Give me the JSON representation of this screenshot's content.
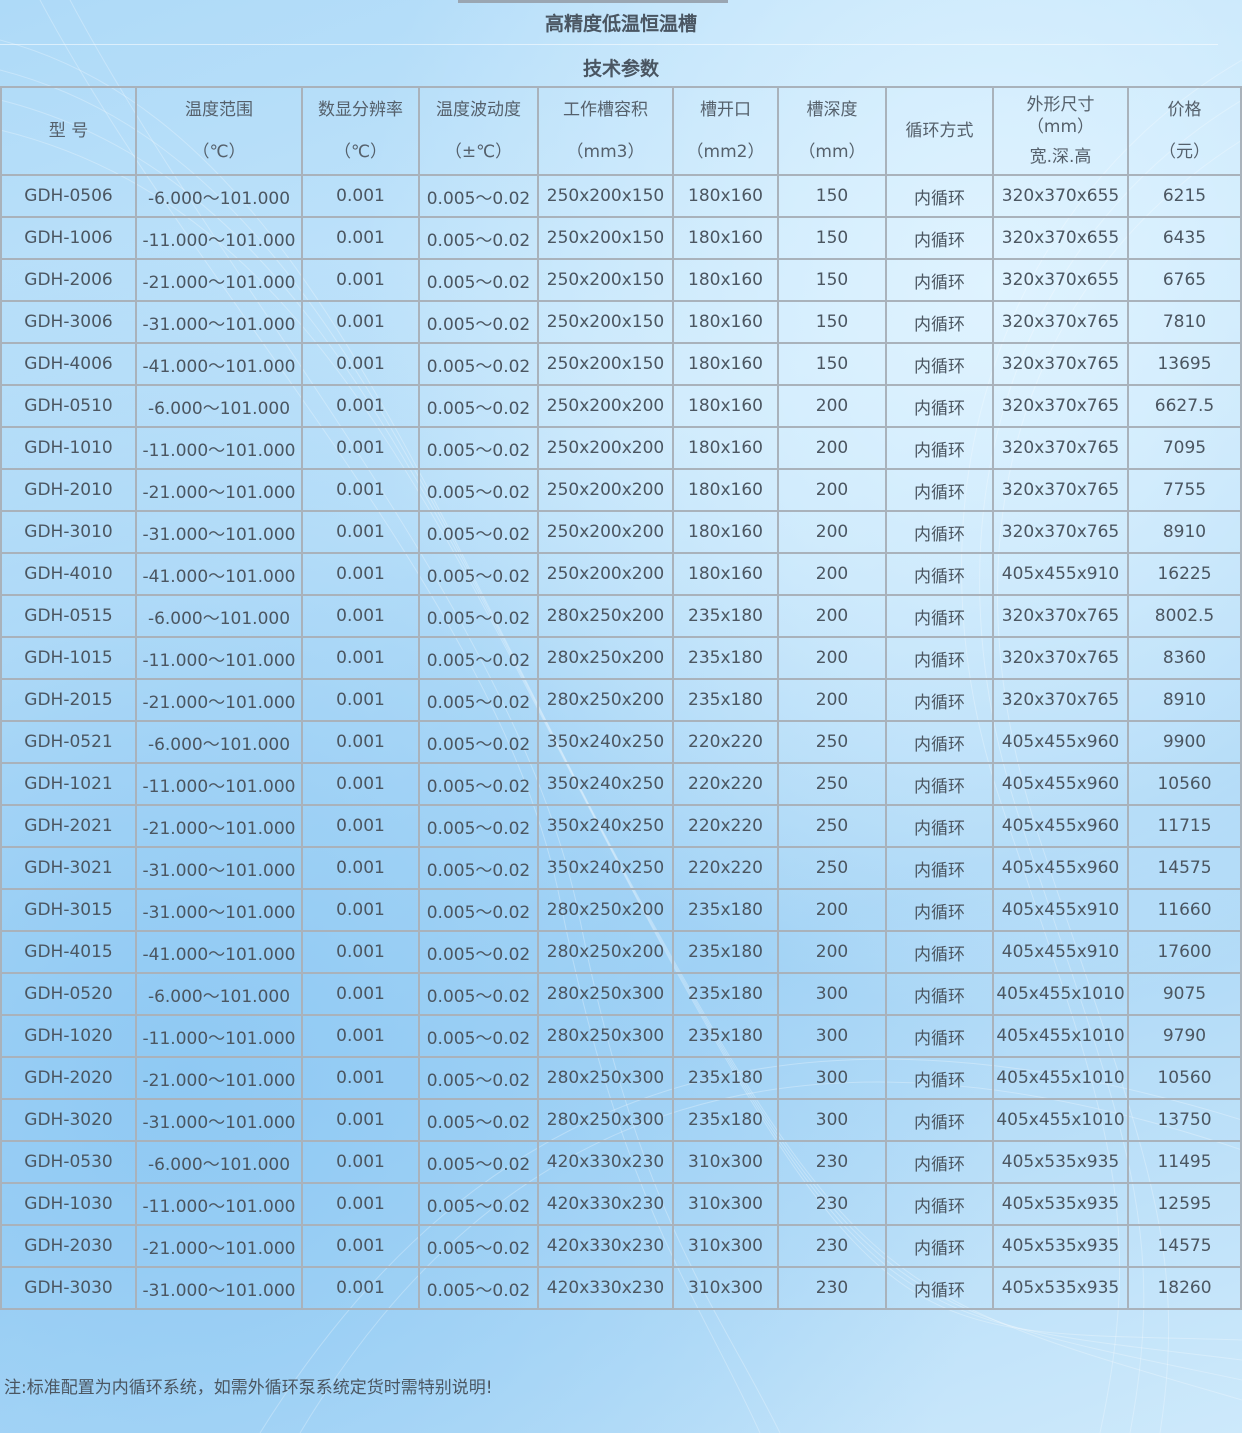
{
  "title": "高精度低温恒温槽",
  "subtitle": "技术参数",
  "headers": {
    "model": "型 号",
    "temp_range": "温度范围",
    "temp_range_unit": "（℃）",
    "resolution": "数显分辨率",
    "resolution_unit": "（℃）",
    "fluctuation": "温度波动度",
    "fluctuation_unit": "（±℃）",
    "volume": "工作槽容积",
    "volume_unit": "（mm3）",
    "opening": "槽开口",
    "opening_unit": "（mm2）",
    "depth": "槽深度",
    "depth_unit": "（mm）",
    "circulation": "循环方式",
    "dims": "外形尺寸",
    "dims_unit": "（mm）",
    "dims_sub": "宽.深.高",
    "price": "价格",
    "price_unit": "（元）"
  },
  "rows": [
    [
      "GDH-0506",
      "-6.000～101.000",
      "0.001",
      "0.005～0.02",
      "250x200x150",
      "180x160",
      "150",
      "内循环",
      "320x370x655",
      "6215"
    ],
    [
      "GDH-1006",
      "-11.000～101.000",
      "0.001",
      "0.005～0.02",
      "250x200x150",
      "180x160",
      "150",
      "内循环",
      "320x370x655",
      "6435"
    ],
    [
      "GDH-2006",
      "-21.000～101.000",
      "0.001",
      "0.005～0.02",
      "250x200x150",
      "180x160",
      "150",
      "内循环",
      "320x370x655",
      "6765"
    ],
    [
      "GDH-3006",
      "-31.000～101.000",
      "0.001",
      "0.005～0.02",
      "250x200x150",
      "180x160",
      "150",
      "内循环",
      "320x370x765",
      "7810"
    ],
    [
      "GDH-4006",
      "-41.000～101.000",
      "0.001",
      "0.005～0.02",
      "250x200x150",
      "180x160",
      "150",
      "内循环",
      "320x370x765",
      "13695"
    ],
    [
      "GDH-0510",
      "-6.000～101.000",
      "0.001",
      "0.005～0.02",
      "250x200x200",
      "180x160",
      "200",
      "内循环",
      "320x370x765",
      "6627.5"
    ],
    [
      "GDH-1010",
      "-11.000～101.000",
      "0.001",
      "0.005～0.02",
      "250x200x200",
      "180x160",
      "200",
      "内循环",
      "320x370x765",
      "7095"
    ],
    [
      "GDH-2010",
      "-21.000～101.000",
      "0.001",
      "0.005～0.02",
      "250x200x200",
      "180x160",
      "200",
      "内循环",
      "320x370x765",
      "7755"
    ],
    [
      "GDH-3010",
      "-31.000～101.000",
      "0.001",
      "0.005～0.02",
      "250x200x200",
      "180x160",
      "200",
      "内循环",
      "320x370x765",
      "8910"
    ],
    [
      "GDH-4010",
      "-41.000～101.000",
      "0.001",
      "0.005～0.02",
      "250x200x200",
      "180x160",
      "200",
      "内循环",
      "405x455x910",
      "16225"
    ],
    [
      "GDH-0515",
      "-6.000～101.000",
      "0.001",
      "0.005～0.02",
      "280x250x200",
      "235x180",
      "200",
      "内循环",
      "320x370x765",
      "8002.5"
    ],
    [
      "GDH-1015",
      "-11.000～101.000",
      "0.001",
      "0.005～0.02",
      "280x250x200",
      "235x180",
      "200",
      "内循环",
      "320x370x765",
      "8360"
    ],
    [
      "GDH-2015",
      "-21.000～101.000",
      "0.001",
      "0.005～0.02",
      "280x250x200",
      "235x180",
      "200",
      "内循环",
      "320x370x765",
      "8910"
    ],
    [
      "GDH-0521",
      "-6.000～101.000",
      "0.001",
      "0.005～0.02",
      "350x240x250",
      "220x220",
      "250",
      "内循环",
      "405x455x960",
      "9900"
    ],
    [
      "GDH-1021",
      "-11.000～101.000",
      "0.001",
      "0.005～0.02",
      "350x240x250",
      "220x220",
      "250",
      "内循环",
      "405x455x960",
      "10560"
    ],
    [
      "GDH-2021",
      "-21.000～101.000",
      "0.001",
      "0.005～0.02",
      "350x240x250",
      "220x220",
      "250",
      "内循环",
      "405x455x960",
      "11715"
    ],
    [
      "GDH-3021",
      "-31.000～101.000",
      "0.001",
      "0.005～0.02",
      "350x240x250",
      "220x220",
      "250",
      "内循环",
      "405x455x960",
      "14575"
    ],
    [
      "GDH-3015",
      "-31.000～101.000",
      "0.001",
      "0.005～0.02",
      "280x250x200",
      "235x180",
      "200",
      "内循环",
      "405x455x910",
      "11660"
    ],
    [
      "GDH-4015",
      "-41.000～101.000",
      "0.001",
      "0.005～0.02",
      "280x250x200",
      "235x180",
      "200",
      "内循环",
      "405x455x910",
      "17600"
    ],
    [
      "GDH-0520",
      "-6.000～101.000",
      "0.001",
      "0.005～0.02",
      "280x250x300",
      "235x180",
      "300",
      "内循环",
      "405x455x1010",
      "9075"
    ],
    [
      "GDH-1020",
      "-11.000～101.000",
      "0.001",
      "0.005～0.02",
      "280x250x300",
      "235x180",
      "300",
      "内循环",
      "405x455x1010",
      "9790"
    ],
    [
      "GDH-2020",
      "-21.000～101.000",
      "0.001",
      "0.005～0.02",
      "280x250x300",
      "235x180",
      "300",
      "内循环",
      "405x455x1010",
      "10560"
    ],
    [
      "GDH-3020",
      "-31.000～101.000",
      "0.001",
      "0.005～0.02",
      "280x250x300",
      "235x180",
      "300",
      "内循环",
      "405x455x1010",
      "13750"
    ],
    [
      "GDH-0530",
      "-6.000～101.000",
      "0.001",
      "0.005～0.02",
      "420x330x230",
      "310x300",
      "230",
      "内循环",
      "405x535x935",
      "11495"
    ],
    [
      "GDH-1030",
      "-11.000～101.000",
      "0.001",
      "0.005～0.02",
      "420x330x230",
      "310x300",
      "230",
      "内循环",
      "405x535x935",
      "12595"
    ],
    [
      "GDH-2030",
      "-21.000～101.000",
      "0.001",
      "0.005～0.02",
      "420x330x230",
      "310x300",
      "230",
      "内循环",
      "405x535x935",
      "14575"
    ],
    [
      "GDH-3030",
      "-31.000～101.000",
      "0.001",
      "0.005～0.02",
      "420x330x230",
      "310x300",
      "230",
      "内循环",
      "405x535x935",
      "18260"
    ]
  ],
  "note": "注:标准配置为内循环系统，如需外循环泵系统定货时需特别说明!",
  "colors": {
    "border": "#a9b2bb",
    "text": "#4b5661",
    "background": "#b4def8"
  }
}
